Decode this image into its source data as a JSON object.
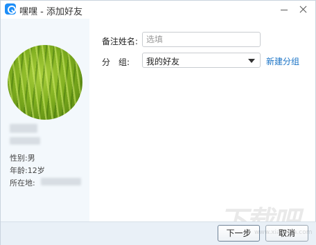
{
  "window": {
    "title": "嘿嘿 - 添加好友",
    "app_icon": "app-logo-icon"
  },
  "profile": {
    "gender_label": "性别:",
    "gender_value": "男",
    "age_label": "年龄:",
    "age_value": "12岁",
    "location_label": "所在地:"
  },
  "form": {
    "remark_label": "备注姓名:",
    "remark_placeholder": "选填",
    "remark_value": "",
    "group_label": "分　组:",
    "group_value": "我的好友",
    "new_group_link": "新建分组"
  },
  "footer": {
    "next_label": "下一步",
    "cancel_label": "取消"
  },
  "watermark": {
    "text": "下载吧",
    "url": "www.xiazaiba.com"
  },
  "colors": {
    "accent": "#1e8ef7",
    "link": "#1a73c6",
    "footer_bg": "#e9f0f7",
    "left_panel_bg": "#f3f8fc"
  }
}
